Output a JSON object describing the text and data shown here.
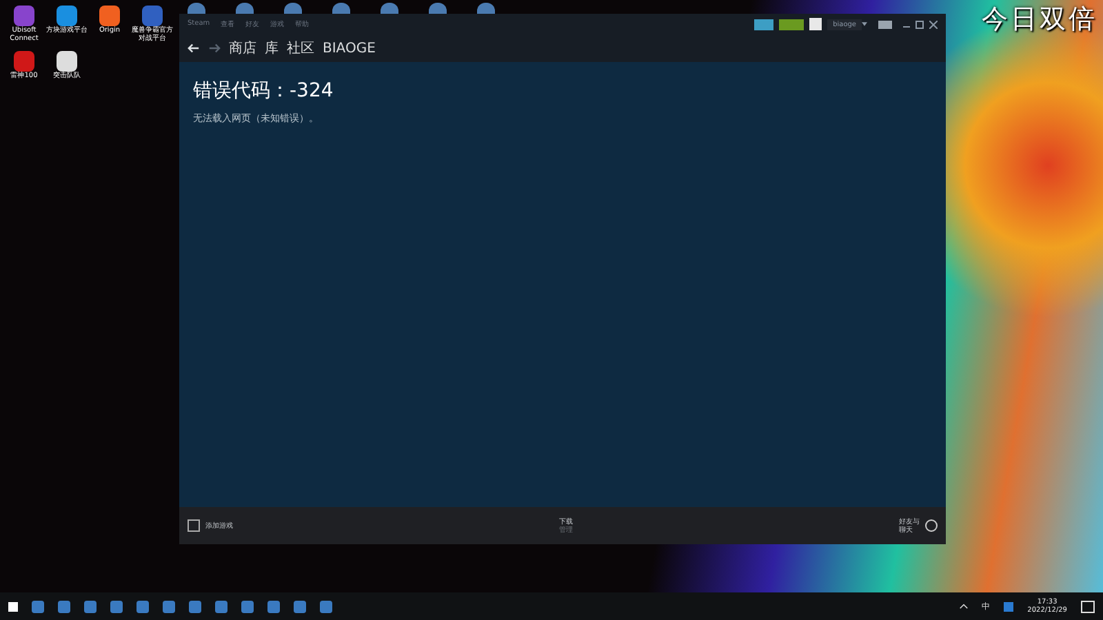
{
  "desktop_icons": [
    {
      "label": "Ubisoft Connect",
      "color": "#8844cc"
    },
    {
      "label": "方块游戏平台",
      "color": "#1a8fe0"
    },
    {
      "label": "Origin",
      "color": "#f06020"
    },
    {
      "label": "魔兽争霸官方对战平台",
      "color": "#3060c0"
    },
    {
      "label": "雷神100",
      "color": "#d01818"
    },
    {
      "label": "突击队队",
      "color": "#dddddd"
    }
  ],
  "overlay_text": "今日双倍",
  "window": {
    "menu": [
      "Steam",
      "查看",
      "好友",
      "游戏",
      "帮助"
    ],
    "username": "biaoge",
    "nav": [
      {
        "label": "商店"
      },
      {
        "label": "库"
      },
      {
        "label": "社区"
      },
      {
        "label": "BIAOGE"
      }
    ],
    "error_title": "错误代码：-324",
    "error_message": "无法载入网页（未知错误）。",
    "footer": {
      "add_game": "添加游戏",
      "downloads": "下载",
      "downloads_sub": "管理",
      "friends": "好友与聊天"
    }
  },
  "taskbar": {
    "ime": "中",
    "time": "17:33",
    "date": "2022/12/29"
  }
}
